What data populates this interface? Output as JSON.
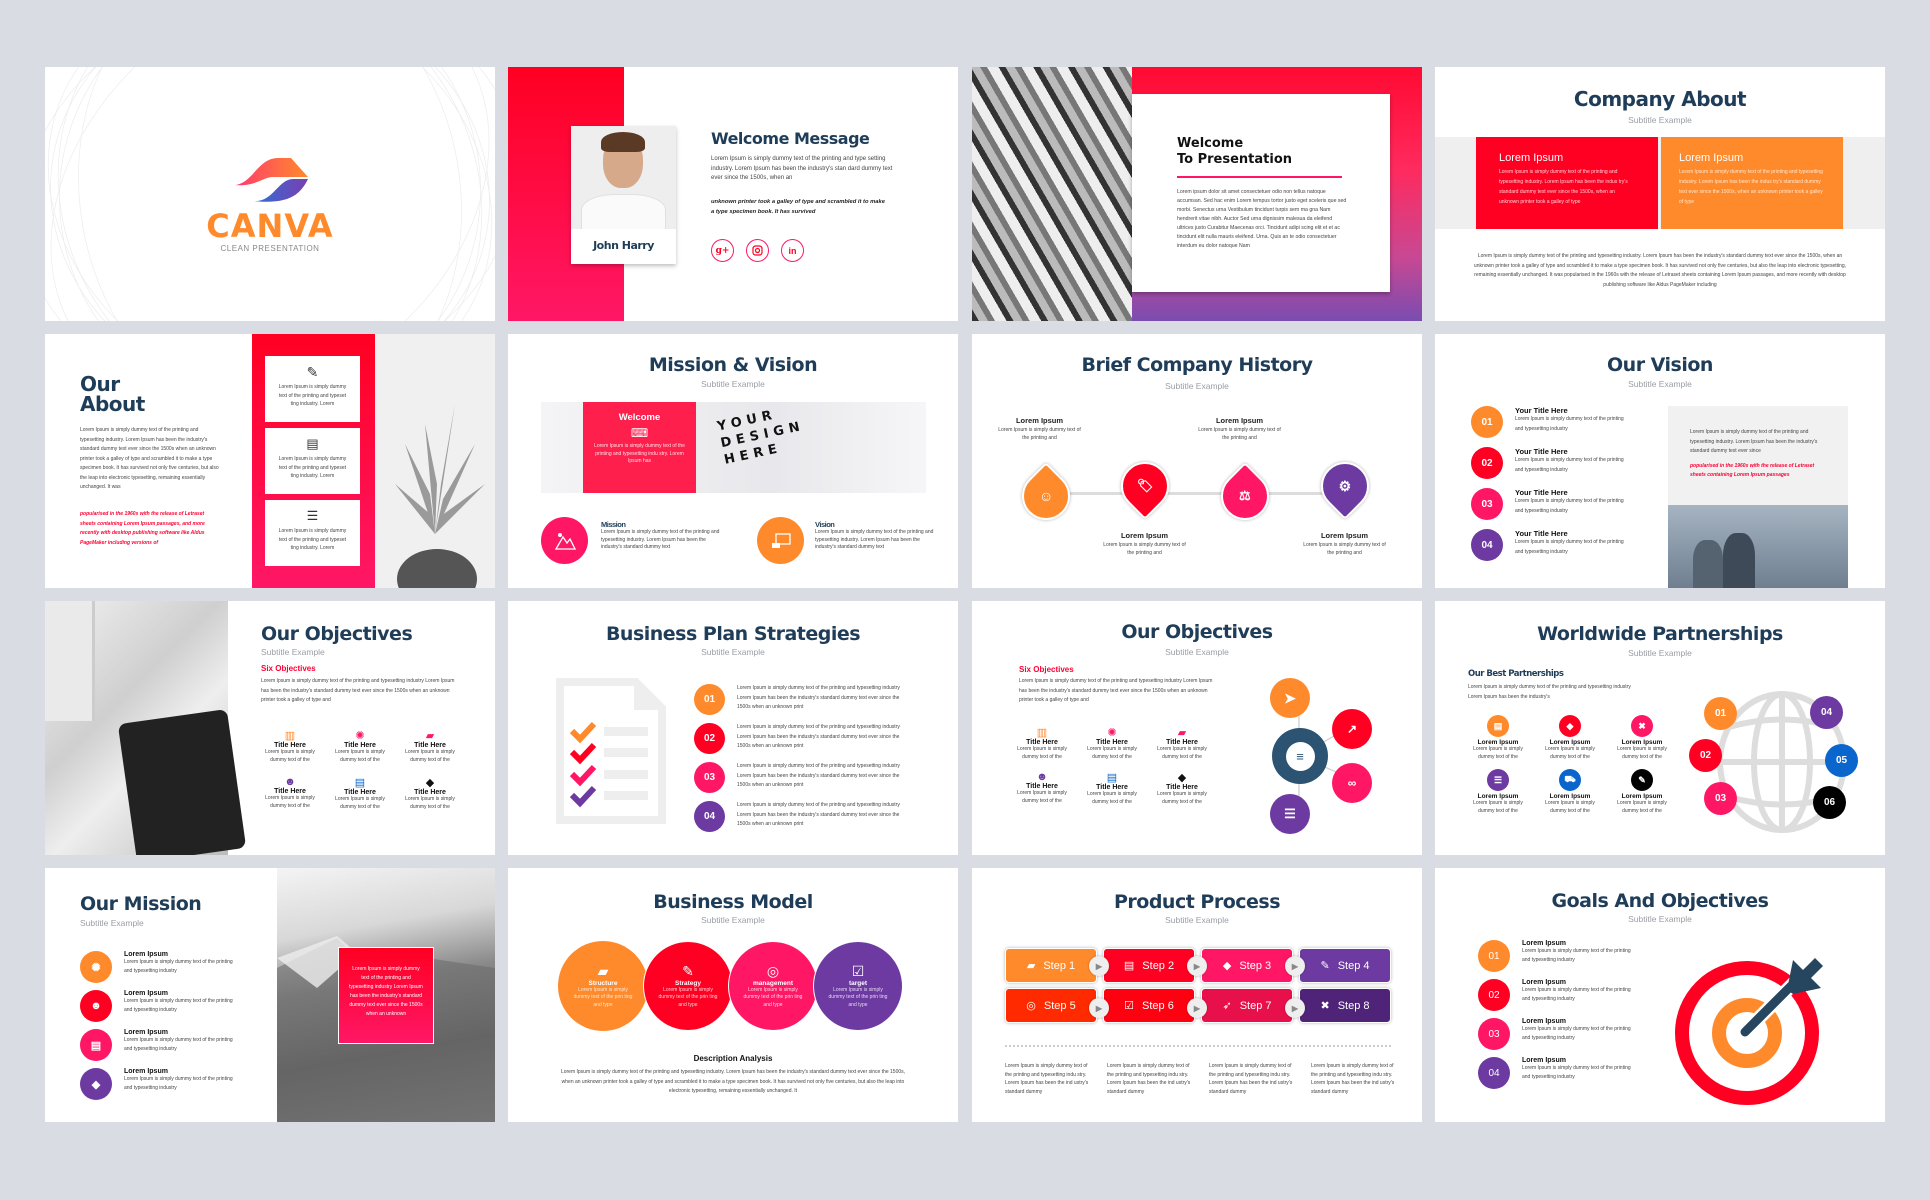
{
  "lorem": {
    "short": "Lorem Ipsum is simply dummy text of the printing and typesetting industry",
    "two": "Lorem Ipsum is simply dummy text of the printing and typesetting industry",
    "card": "Lorem Ipsum is simply dummy text of the printing and typeset ting industry. Lorem",
    "tiny": "Lorem Ipsum is simply dummy text of the",
    "hist": "Lorem Ipsum is simply dummy text of the printing and",
    "plan": "Lorem Ipsum is simply dummy text of the printing and typesetting industry Lorem Ipsum has been the industry's standard dummy text ever since the 1500s when an unknown print",
    "process": "Lorem Ipsum is simply dummy text of the printing and typesetting industry. Lorem Ipsum has been the industry's standard dummy",
    "bm": "Lorem Ipsum is simply dummy text of the prin ting and type"
  },
  "subtitle": "Subtitle Example",
  "slide1": {
    "logo": "CANVA",
    "tagline": "CLEAN PRESENTATION"
  },
  "slide2": {
    "title": "Welcome Message",
    "name": "John Harry",
    "body": "Lorem Ipsum is simply dummy text of the printing and type setting industry. Lorem Ipsum has been the industry's stan dard dummy text ever since the 1500s, when an",
    "italic": "unknown printer took a galley of type and scrambled it to make a type specimen book. It has survived",
    "social": [
      "g+",
      "ig",
      "in"
    ]
  },
  "slide3": {
    "title1": "Welcome",
    "title2": "To Presentation",
    "body": "Lorem ipsum dolor sit amet consectetuer odio non tellus natoque accumsan. Sed hac enim Lorem tempus tortor justo eget sceleris que sed morbi. Senectus urna Vestibulum tincidunt turpis sem ma gna Nam hendrerit vitae nibh. Auctor Sed urna dignissim malesua da eleifend ultrices justo Curabitur Maecenas orci. Tincidunt adipi scing elit et et ac tincidunt elit nulla mauris eleifend. Urna. Quis an te odio consectetuer interdum eu dolor natoque Nam"
  },
  "slide4": {
    "title": "Company About",
    "cards": [
      {
        "title": "Lorem Ipsum",
        "text": "Lorem Ipsum is simply dummy text of the printing and typesetting industry. Lorem Ipsum has been the indus try's standard dummy text ever since the 1500s, when an unknown printer took a galley of type"
      },
      {
        "title": "Lorem Ipsum",
        "text": "Lorem Ipsum is simply dummy text of the printing and typesetting industry. Lorem Ipsum has been the indus try's standard dummy text ever since the 1500s, when an unknown printer took a galley of type"
      }
    ],
    "body": "Lorem Ipsum is simply dummy text of the printing and typesetting industry. Lorem Ipsum has been the industry's standard dummy text ever since the 1500s, when an unknown printer took a galley of type and scrambled it to make a type specimen book. It has survived not only five centuries, but also the leap into electronic typesetting, remaining essentially unchanged. It was popularised in the 1960s with the release of Letraset sheets containing Lorem Ipsum passages, and more recently with desktop publishing software like Aldus PageMaker including"
  },
  "slide5": {
    "title1": "Our",
    "title2": "About",
    "body": "Lorem Ipsum is simply dummy text of the printing and typesetting industry. Lorem Ipsum has been the industry's standard dummy text ever since the 1500s when an unknown printer took a galley of type and scrambled it to make a type specimen book. It has survived not only five centuries, but also the leap into electronic typesetting, remaining essentially unchanged. It was",
    "italic": "popularised in the 1960s with the release of Letraset sheets containing Lorem Ipsum passages, and more recently with desktop publishing software like Aldus PageMaker including versions of"
  },
  "slide6": {
    "title": "Mission & Vision",
    "banner_title": "Welcome",
    "banner_text": "Lorem Ipsum is simply dummy text of the printing and typesetting indu stry. Lorem Ipsum has",
    "design_text": "YOUR DESIGN HERE",
    "items": [
      {
        "title": "Mission",
        "text": "Lorem Ipsum is simply dummy text of the printing and typesetting industry. Lorem Ipsum has been the industry's standard dummy text"
      },
      {
        "title": "Vision",
        "text": "Lorem Ipsum is simply dummy text of the printing and typesetting industry. Lorem Ipsum has been the industry's standard dummy text"
      }
    ]
  },
  "slide7": {
    "title": "Brief Company History",
    "items": [
      {
        "title": "Lorem Ipsum",
        "text": "Lorem Ipsum is simply dummy text of the printing and",
        "icon": "headset-icon"
      },
      {
        "title": "Lorem Ipsum",
        "text": "Lorem Ipsum is simply dummy text of the printing and",
        "icon": "tag-icon"
      },
      {
        "title": "Lorem Ipsum",
        "text": "Lorem Ipsum is simply dummy text of the printing and",
        "icon": "gavel-icon"
      },
      {
        "title": "Lorem Ipsum",
        "text": "Lorem Ipsum is simply dummy text of the printing and",
        "icon": "gear-leaf-icon"
      }
    ]
  },
  "slide8": {
    "title": "Our Vision",
    "items": [
      {
        "num": "01",
        "title": "Your Title Here",
        "text": "Lorem Ipsum is simply dummy text of the printing and typesetting industry"
      },
      {
        "num": "02",
        "title": "Your Title Here",
        "text": "Lorem Ipsum is simply dummy text of the printing and typesetting industry"
      },
      {
        "num": "03",
        "title": "Your Title Here",
        "text": "Lorem Ipsum is simply dummy text of the printing and typesetting industry"
      },
      {
        "num": "04",
        "title": "Your Title Here",
        "text": "Lorem Ipsum is simply dummy text of the printing and typesetting industry"
      }
    ],
    "panel_text": "Lorem Ipsum is simply dummy text of the printing and typesetting industry. Lorem Ipsum has been the industry's standard dummy text ever since",
    "panel_italic": "popularised in the 1960s with the release of Letraset sheets containing Lorem Ipsum passages"
  },
  "objectives": {
    "title": "Our Objectives",
    "heading": "Six Objectives",
    "body": "Lorem Ipsum is simply dummy text of the printing and typesetting industry Lorem Ipsum has been the industry's standard dummy text ever since the 1500s when an unknown printer took a galley of type and",
    "items": [
      {
        "title": "Title Here",
        "text": "Lorem Ipsum is simply dummy text of the"
      },
      {
        "title": "Title Here",
        "text": "Lorem Ipsum is simply dummy text of the"
      },
      {
        "title": "Title Here",
        "text": "Lorem Ipsum is simply dummy text of the"
      },
      {
        "title": "Title Here",
        "text": "Lorem Ipsum is simply dummy text of the"
      },
      {
        "title": "Title Here",
        "text": "Lorem Ipsum is simply dummy text of the"
      },
      {
        "title": "Title Here",
        "text": "Lorem Ipsum is simply dummy text of the"
      }
    ]
  },
  "slide10": {
    "title": "Business Plan Strategies",
    "items": [
      "01",
      "02",
      "03",
      "04"
    ]
  },
  "slide12": {
    "title": "Worldwide Partnerships",
    "heading": "Our Best Partnerships",
    "body": "Lorem Ipsum is simply dummy text of the printing and typesetting industry Lorem Ipsum has been the industry's",
    "items": [
      {
        "title": "Lorem Ipsum",
        "text": "Lorem Ipsum is simply dummy text of the"
      },
      {
        "title": "Lorem Ipsum",
        "text": "Lorem Ipsum is simply dummy text of the"
      },
      {
        "title": "Lorem Ipsum",
        "text": "Lorem Ipsum is simply dummy text of the"
      },
      {
        "title": "Lorem Ipsum",
        "text": "Lorem Ipsum is simply dummy text of the"
      },
      {
        "title": "Lorem Ipsum",
        "text": "Lorem Ipsum is simply dummy text of the"
      },
      {
        "title": "Lorem Ipsum",
        "text": "Lorem Ipsum is simply dummy text of the"
      }
    ],
    "globe_nums": [
      "01",
      "02",
      "03",
      "04",
      "05",
      "06"
    ]
  },
  "slide13": {
    "title": "Our Mission",
    "items": [
      {
        "title": "Lorem Ipsum",
        "text": "Lorem Ipsum is simply dummy text of the printing and typesetting industry"
      },
      {
        "title": "Lorem Ipsum",
        "text": "Lorem Ipsum is simply dummy text of the printing and typesetting industry"
      },
      {
        "title": "Lorem Ipsum",
        "text": "Lorem Ipsum is simply dummy text of the printing and typesetting industry"
      },
      {
        "title": "Lorem Ipsum",
        "text": "Lorem Ipsum is simply dummy text of the printing and typesetting industry"
      }
    ],
    "box_text": "Lorem Ipsum is simply dummy text of the printing and typesetting industry Lorem Ipsum has been the industry's standard dummy text ever since the 1500s when an unknown"
  },
  "slide14": {
    "title": "Business Model",
    "items": [
      {
        "title": "Structure",
        "text": "Lorem Ipsum is simply dummy text of the prin ting and type"
      },
      {
        "title": "Strategy",
        "text": "Lorem Ipsum is simply dummy text of the prin ting and type"
      },
      {
        "title": "management",
        "text": "Lorem Ipsum is simply dummy text of the prin ting and type"
      },
      {
        "title": "target",
        "text": "Lorem Ipsum is simply dummy text of the prin ting and type"
      }
    ],
    "desc_title": "Description Analysis",
    "desc": "Lorem Ipsum is simply dummy text of the printing and typesetting industry. Lorem Ipsum has been the industry's standard dummy text ever since the 1500s, when an unknown printer took a galley of type and scrambled it to make a type specimen book. It has survived not only five centuries, but also the leap into electronic typesetting, remaining essentially unchanged. It"
  },
  "slide15": {
    "title": "Product Process",
    "steps": [
      "Step 1",
      "Step 2",
      "Step 3",
      "Step 4",
      "Step 5",
      "Step 6",
      "Step 7",
      "Step 8"
    ],
    "cols": [
      "Lorem Ipsum is simply dummy text of the printing and typesetting indu stry. Lorem Ipsum has been the ind ustry's standard dummy",
      "Lorem Ipsum is simply dummy text of the printing and typesetting indu stry. Lorem Ipsum has been the ind ustry's standard dummy",
      "Lorem Ipsum is simply dummy text of the printing and typesetting indu stry. Lorem Ipsum has been the ind ustry's standard dummy",
      "Lorem Ipsum is simply dummy text of the printing and typesetting indu stry. Lorem Ipsum has been the ind ustry's standard dummy"
    ]
  },
  "slide16": {
    "title": "Goals And Objectives",
    "items": [
      {
        "num": "01",
        "title": "Lorem Ipsum",
        "text": "Lorem Ipsum is simply dummy text of the printing and typesetting industry"
      },
      {
        "num": "02",
        "title": "Lorem Ipsum",
        "text": "Lorem Ipsum is simply dummy text of the printing and typesetting industry"
      },
      {
        "num": "03",
        "title": "Lorem Ipsum",
        "text": "Lorem Ipsum is simply dummy text of the printing and typesetting industry"
      },
      {
        "num": "04",
        "title": "Lorem Ipsum",
        "text": "Lorem Ipsum is simply dummy text of the printing and typesetting industry"
      }
    ]
  },
  "colors": {
    "orange": "#ff8a2b",
    "red": "#ff0022",
    "pink": "#ff1766",
    "purple": "#6c3aa0",
    "navy": "#1f3d58",
    "blue": "#0a66cc"
  }
}
